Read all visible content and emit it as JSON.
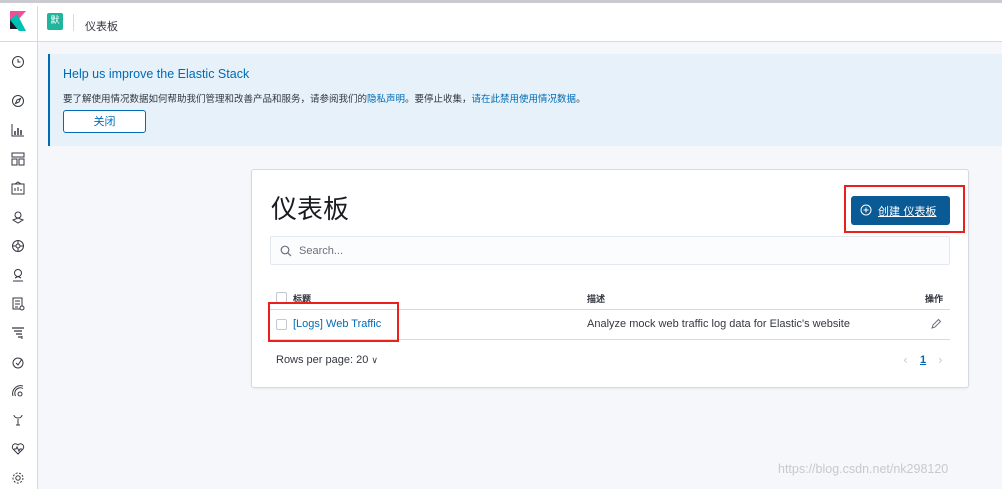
{
  "header": {
    "logo": "kibana-logo",
    "space_initial": "默",
    "breadcrumb": "仪表板"
  },
  "sidenav": {
    "icons": [
      "clock-icon",
      "discover-icon",
      "visualize-icon",
      "dashboard-icon",
      "canvas-icon",
      "maps-icon",
      "ml-icon",
      "infrastructure-icon",
      "logs-icon",
      "apm-icon",
      "uptime-icon",
      "siem-icon",
      "dev-tools-icon",
      "monitoring-icon",
      "management-icon"
    ]
  },
  "callout": {
    "title": "Help us improve the Elastic Stack",
    "text_1": "要了解使用情况数据如何帮助我们管理和改善产品和服务，请参阅我们的",
    "privacy_link": "隐私声明",
    "text_2": "。要停止收集，",
    "disable_link": "请在此禁用使用情况数据",
    "text_3": "。",
    "close_label": "关闭"
  },
  "main": {
    "title": "仪表板",
    "create_button": "创建 仪表板",
    "search_placeholder": "Search...",
    "columns": {
      "title": "标题",
      "description": "描述",
      "actions": "操作"
    },
    "rows": [
      {
        "title": "[Logs] Web Traffic",
        "description": "Analyze mock web traffic log data for Elastic's website"
      }
    ],
    "rows_per_page": "Rows per page: 20",
    "pager": {
      "prev": "‹",
      "current": "1",
      "next": "›"
    }
  },
  "watermark": "https://blog.csdn.net/nk298120",
  "colors": {
    "primary": "#006bb4",
    "create_button": "#0a5a96",
    "callout_bg": "#e6f1fa",
    "highlight": "#e8211d",
    "space_avatar": "#20b59c"
  }
}
